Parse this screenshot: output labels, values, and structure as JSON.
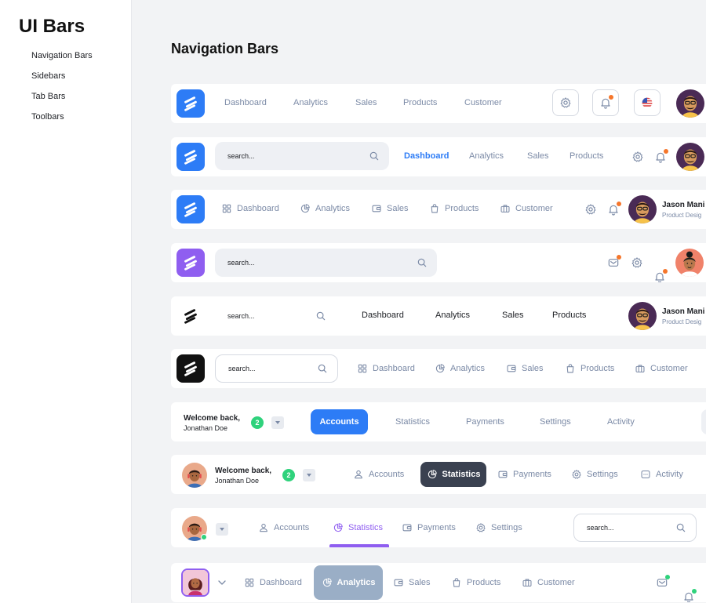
{
  "sidebar": {
    "title": "UI Bars",
    "items": [
      "Navigation Bars",
      "Sidebars",
      "Tab Bars",
      "Toolbars"
    ]
  },
  "page_title": "Navigation Bars",
  "colors": {
    "accent": "#2d7cf6",
    "purple": "#8f5ef0",
    "notify": "#f5762b",
    "online": "#2fd27c"
  },
  "bar1": {
    "nav": [
      "Dashboard",
      "Analytics",
      "Sales",
      "Products",
      "Customer"
    ]
  },
  "bar2": {
    "search_placeholder": "search...",
    "nav": [
      "Dashboard",
      "Analytics",
      "Sales",
      "Products"
    ],
    "active": "Dashboard"
  },
  "bar3": {
    "nav": [
      "Dashboard",
      "Analytics",
      "Sales",
      "Products",
      "Customer"
    ],
    "user_name": "Jason Mani",
    "user_role": "Product Desig"
  },
  "bar4": {
    "search_placeholder": "search..."
  },
  "bar5": {
    "search_placeholder": "search...",
    "nav": [
      "Dashboard",
      "Analytics",
      "Sales",
      "Products"
    ],
    "user_name": "Jason Mani",
    "user_role": "Product Desig"
  },
  "bar6": {
    "search_placeholder": "search...",
    "nav": [
      "Dashboard",
      "Analytics",
      "Sales",
      "Products",
      "Customer"
    ]
  },
  "bar7": {
    "welcome": "Welcome back,",
    "name": "Jonathan Doe",
    "count": "2",
    "tabs": [
      "Accounts",
      "Statistics",
      "Payments",
      "Settings",
      "Activity"
    ],
    "active": "Accounts"
  },
  "bar8": {
    "welcome": "Welcome back,",
    "name": "Jonathan Doe",
    "count": "2",
    "tabs": [
      "Accounts",
      "Statistics",
      "Payments",
      "Settings",
      "Activity"
    ],
    "active": "Statistics"
  },
  "bar9": {
    "tabs": [
      "Accounts",
      "Statistics",
      "Payments",
      "Settings"
    ],
    "active": "Statistics",
    "search_placeholder": "search..."
  },
  "bar10": {
    "nav": [
      "Dashboard",
      "Analytics",
      "Sales",
      "Products",
      "Customer"
    ],
    "active": "Analytics"
  }
}
